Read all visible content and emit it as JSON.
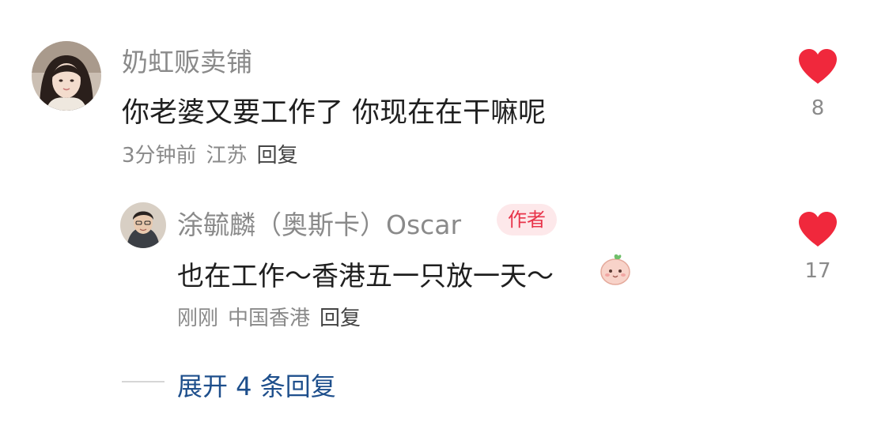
{
  "comments": [
    {
      "author": "奶虹贩卖铺",
      "text": "你老婆又要工作了 你现在在干嘛呢",
      "time": "3分钟前",
      "location": "江苏",
      "reply_label": "回复",
      "likes": "8"
    },
    {
      "author": "涂毓麟（奥斯卡）Oscar",
      "badge": "作者",
      "text": "也在工作～香港五一只放一天～",
      "emoji": "emoji-face-icon",
      "time": "刚刚",
      "location": "中国香港",
      "reply_label": "回复",
      "likes": "17"
    }
  ],
  "expand": {
    "label": "展开 4 条回复"
  },
  "colors": {
    "heart": "#f0283c",
    "accent_blue": "#1e4f8c",
    "badge_bg": "#fde8ea",
    "badge_text": "#e8344a"
  }
}
